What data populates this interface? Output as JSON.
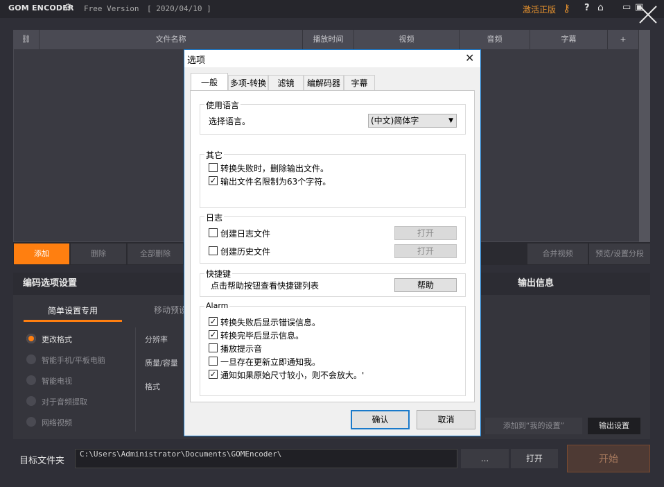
{
  "titlebar": {
    "logo": "GOM ENCODER",
    "version": "Free Version",
    "date": "[ 2020/04/10 ]",
    "activate": "激活正版",
    "help": "?"
  },
  "file_table": {
    "columns": [
      "文件名称",
      "播放时间",
      "视频",
      "音频",
      "字幕",
      "+"
    ]
  },
  "toolbar": {
    "add": "添加",
    "delete": "删除",
    "delete_all": "全部删除",
    "merge": "合并视频",
    "preview": "预览/设置分段"
  },
  "encode_panel": {
    "title": "编码选项设置",
    "tab_simple": "简单设置专用",
    "tab_mobile": "移动预设",
    "options": [
      {
        "label": "更改格式",
        "selected": true
      },
      {
        "label": "智能手机/平板电脑",
        "selected": false
      },
      {
        "label": "智能电视",
        "selected": false
      },
      {
        "label": "对于音频提取",
        "selected": false
      },
      {
        "label": "网络视频",
        "selected": false
      }
    ],
    "settings": [
      "分辨率",
      "质量/容量",
      "格式"
    ]
  },
  "output_panel": {
    "title": "输出信息",
    "add_mine": "添加到“我的设置”",
    "output_settings": "输出设置"
  },
  "bottom": {
    "target_label": "目标文件夹",
    "target_path": "C:\\Users\\Administrator\\Documents\\GOMEncoder\\",
    "browse": "...",
    "open": "打开",
    "start": "开始"
  },
  "dialog": {
    "title": "选项",
    "tabs": [
      "一般",
      "多项-转换",
      "滤镜",
      "编解码器",
      "字幕"
    ],
    "language": {
      "group": "使用语言",
      "label": "选择语言。",
      "value": "(中文)简体字"
    },
    "other": {
      "group": "其它",
      "items": [
        {
          "label": "转换失败时，删除输出文件。",
          "checked": false
        },
        {
          "label": "输出文件名限制为63个字符。",
          "checked": true
        }
      ]
    },
    "log": {
      "group": "日志",
      "items": [
        {
          "label": "创建日志文件",
          "checked": false,
          "button": "打开"
        },
        {
          "label": "创建历史文件",
          "checked": false,
          "button": "打开"
        }
      ]
    },
    "shortcut": {
      "group": "快捷键",
      "label": "点击帮助按钮查看快捷键列表",
      "button": "帮助"
    },
    "alarm": {
      "group": "Alarm",
      "items": [
        {
          "label": "转换失败后显示错误信息。",
          "checked": true
        },
        {
          "label": "转换完毕后显示信息。",
          "checked": true
        },
        {
          "label": "播放提示音",
          "checked": false
        },
        {
          "label": "一旦存在更新立即通知我。",
          "checked": false
        },
        {
          "label": "通知如果原始尺寸较小，则不会放大。'",
          "checked": true
        }
      ]
    },
    "ok": "确认",
    "cancel": "取消"
  },
  "colors": {
    "accent": "#ff7f10",
    "dialog_border": "#1979ca",
    "activate": "#e8932e"
  }
}
